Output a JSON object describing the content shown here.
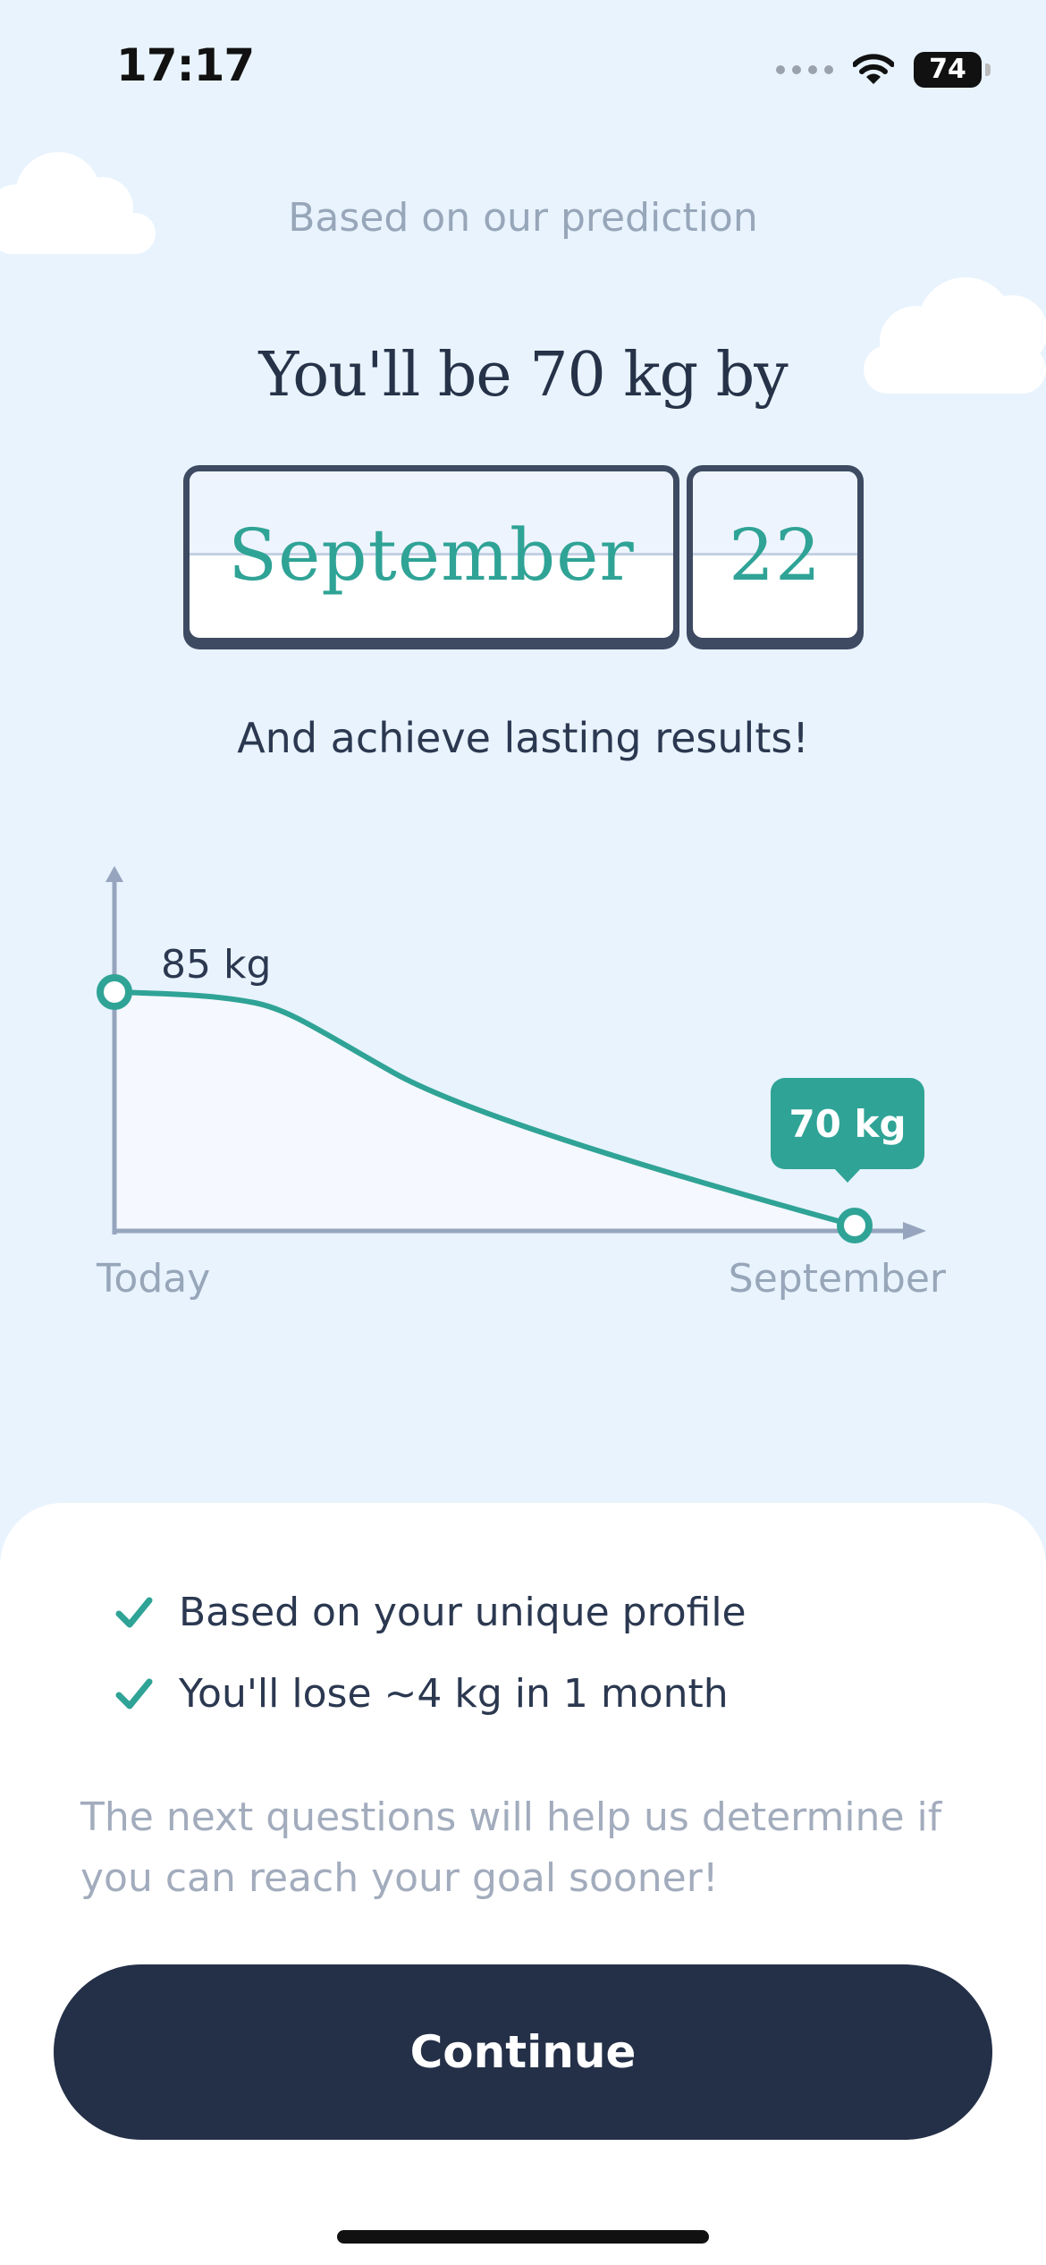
{
  "status_bar": {
    "time": "17:17",
    "battery": "74",
    "icons": [
      "signal-dots-icon",
      "wifi-icon",
      "battery-icon"
    ]
  },
  "header": {
    "subtitle": "Based on our prediction",
    "headline": "You'll be 70 kg by"
  },
  "date": {
    "month": "September",
    "day": "22"
  },
  "tagline": "And achieve lasting results!",
  "chart_data": {
    "type": "line",
    "x": [
      "Today",
      "September"
    ],
    "series": [
      {
        "values": [
          85,
          70
        ]
      }
    ],
    "start_label": "85 kg",
    "end_label": "70 kg",
    "line_color": "#2fa396",
    "axis_color": "#96a5bd"
  },
  "sheet": {
    "checks": [
      {
        "text": "Based on your unique profile",
        "icon": "checkmark-icon"
      },
      {
        "text": "You'll lose ~4 kg in 1 month",
        "icon": "checkmark-icon"
      }
    ],
    "note": "The next questions will help us determine if you can reach your goal sooner!",
    "continue_label": "Continue"
  },
  "colors": {
    "background": "#e8f3fd",
    "accent": "#2fa396",
    "button": "#243048",
    "text_dark": "#263248",
    "text_muted": "#97a6b9"
  }
}
